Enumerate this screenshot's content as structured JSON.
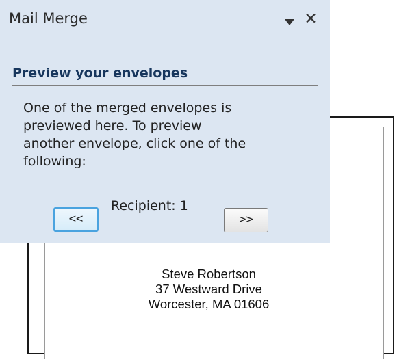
{
  "task_pane": {
    "title": "Mail Merge",
    "menu_icon": "dropdown-triangle-icon",
    "close_icon": "close-icon",
    "close_glyph": "✕",
    "section_heading": "Preview your envelopes",
    "instructions": [
      "One of the merged envelopes is",
      "previewed here. To preview",
      "another envelope, click one of the",
      "following:"
    ],
    "prev_button_label": "<<",
    "recipient_label": "Recipient: 1",
    "next_button_label": ">>"
  },
  "envelope": {
    "address_lines": [
      "Steve Robertson",
      "37 Westward Drive",
      "Worcester, MA 01606"
    ]
  },
  "colors": {
    "pane_background": "#dce6f2",
    "heading": "#17365d",
    "selected_button_border": "#4aa3df"
  }
}
